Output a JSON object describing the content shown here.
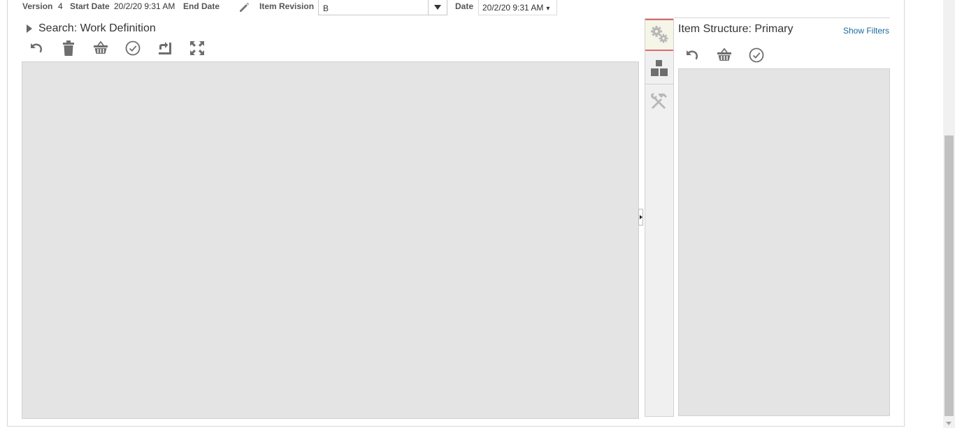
{
  "header": {
    "version_label": "Version",
    "version_value": "4",
    "start_date_label": "Start Date",
    "start_date_value": "20/2/20 9:31 AM",
    "end_date_label": "End Date",
    "item_revision_label": "Item Revision",
    "item_revision_value": "B",
    "date_label": "Date",
    "date_value": "20/2/20 9:31 AM",
    "date_caret": "▾"
  },
  "search_panel": {
    "title": "Search: Work Definition",
    "toolbar": [
      "undo-icon",
      "delete-icon",
      "basket-icon",
      "check-circle-icon",
      "refresh-icon",
      "expand-icon"
    ]
  },
  "side_tabs": [
    "gears-icon",
    "blocks-icon",
    "tools-icon"
  ],
  "item_structure": {
    "title": "Item Structure: Primary",
    "show_filters": "Show Filters",
    "toolbar": [
      "undo-icon",
      "basket-icon",
      "check-circle-icon"
    ]
  },
  "colors": {
    "canvas_bg": "#e4e4e4",
    "icon_gray": "#6e6e6e",
    "link_blue": "#1a6aa0",
    "active_tab_border": "#e06a6a"
  }
}
